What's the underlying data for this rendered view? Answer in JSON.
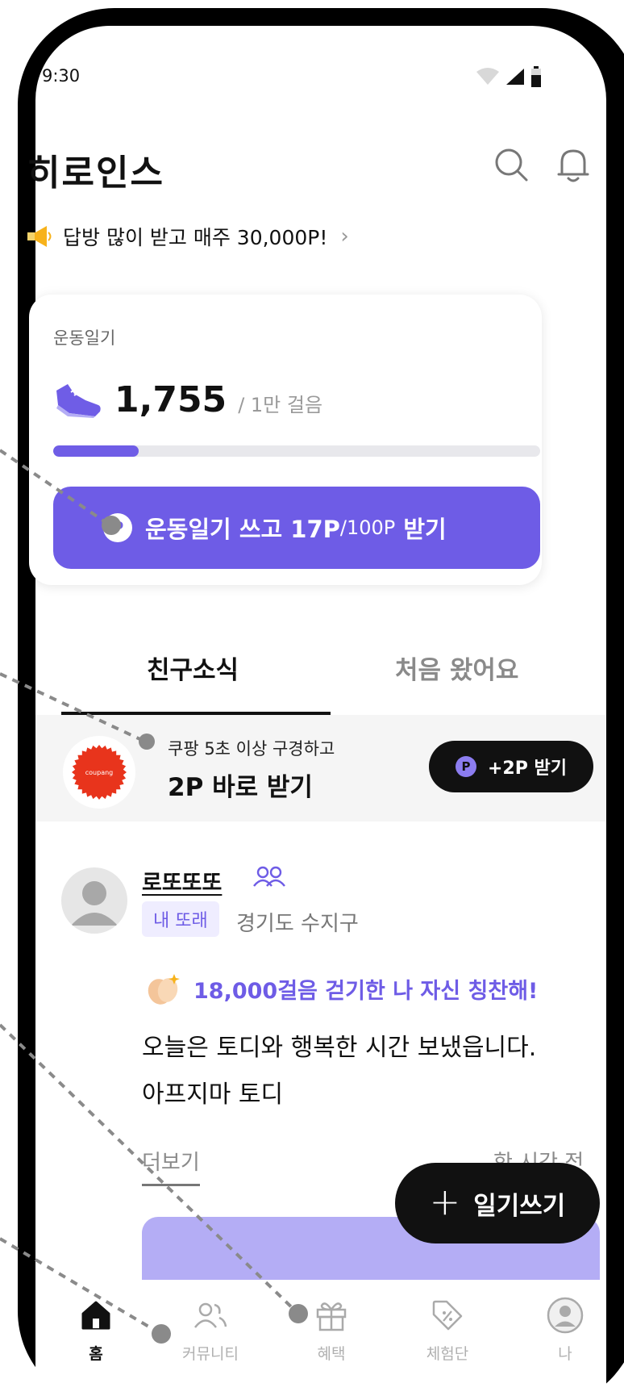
{
  "status_bar": {
    "time": "9:30"
  },
  "header": {
    "app_title": "히로인스"
  },
  "promo": {
    "text": "답방 많이 받고 매주 30,000P!"
  },
  "exercise_card": {
    "label": "운동일기",
    "steps": "1,755",
    "goal": "/ 1만 걸음",
    "progress_fraction": 0.1755,
    "cta_main": "운동일기 쓰고 17P",
    "cta_small": "/100P",
    "cta_suffix": " 받기",
    "p_badge": "P"
  },
  "tabs": [
    {
      "label": "친구소식",
      "active": true
    },
    {
      "label": "처음 왔어요",
      "active": false
    }
  ],
  "ad": {
    "logo_text": "coupang",
    "line1": "쿠팡 5초 이상 구경하고",
    "line2": "2P 바로 받기",
    "button_badge": "P",
    "button_label": "+2P 받기"
  },
  "post": {
    "username": "로또또또",
    "tag": "내 또래",
    "location": "경기도 수지구",
    "headline": "18,000걸음 걷기한 나 자신 칭찬해!",
    "body_line1": "오늘은 토디와 행복한 시간 보냈읍니다.",
    "body_line2": "아프지마 토디",
    "more": "더보기",
    "time": "한 시간 전"
  },
  "fab": {
    "label": "일기쓰기"
  },
  "bottom_nav": [
    {
      "label": "홈",
      "icon": "home-icon",
      "active": true
    },
    {
      "label": "커뮤니티",
      "icon": "community-icon",
      "active": false
    },
    {
      "label": "혜택",
      "icon": "gift-icon",
      "active": false
    },
    {
      "label": "체험단",
      "icon": "tag-icon",
      "active": false
    },
    {
      "label": "나",
      "icon": "profile-icon",
      "active": false
    }
  ],
  "colors": {
    "accent": "#6e5ce6",
    "accent_light": "#b4adf5",
    "coupang_red": "#e8341c"
  }
}
